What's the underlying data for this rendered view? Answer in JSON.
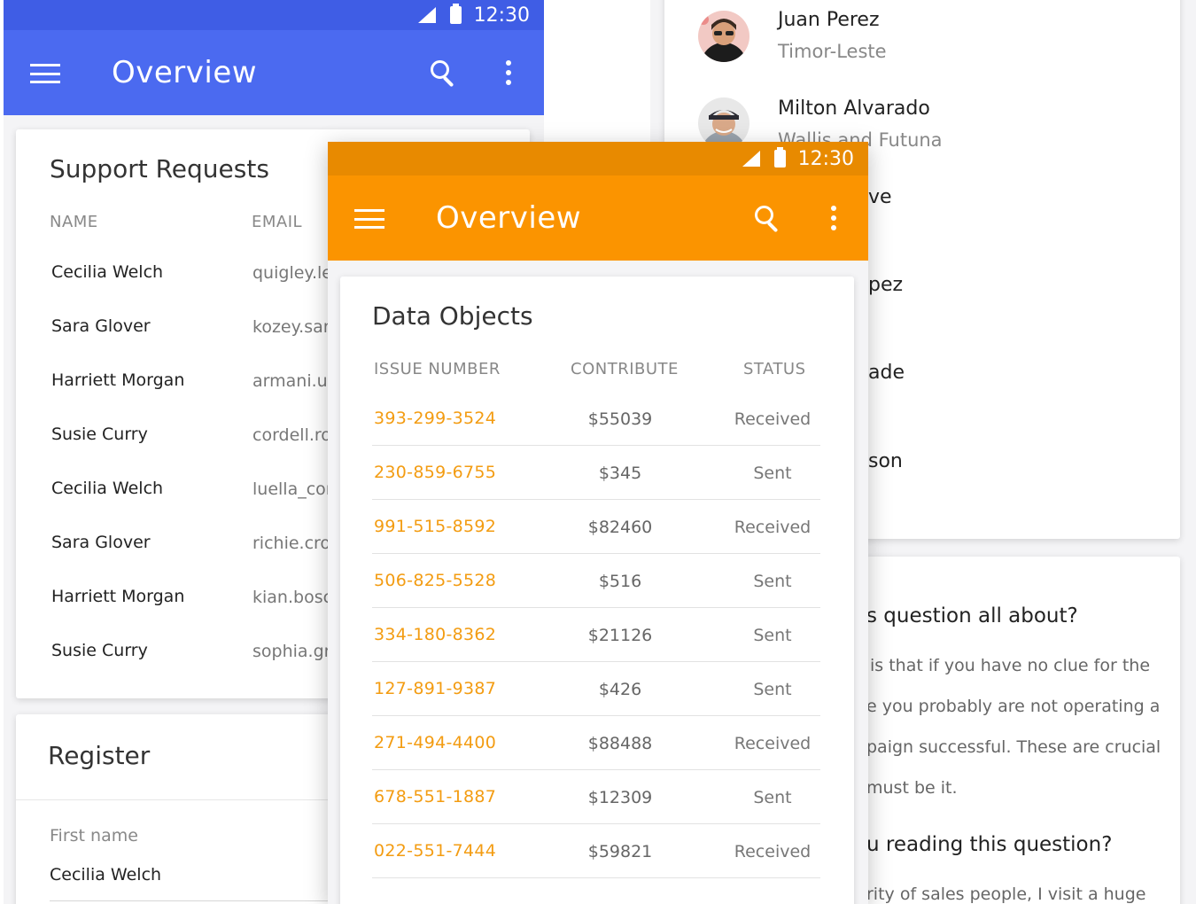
{
  "blue_phone": {
    "status_time": "12:30",
    "title": "Overview",
    "accent": "#4b6af0",
    "support": {
      "title": "Support Requests",
      "columns": [
        "NAME",
        "EMAIL"
      ],
      "rows": [
        {
          "name": "Cecilia Welch",
          "email": "quigley.le"
        },
        {
          "name": "Sara Glover",
          "email": "kozey.san"
        },
        {
          "name": "Harriett Morgan",
          "email": "armani.up"
        },
        {
          "name": "Susie Curry",
          "email": "cordell.ro"
        },
        {
          "name": "Cecilia Welch",
          "email": "luella_cor"
        },
        {
          "name": "Sara Glover",
          "email": "richie.cro"
        },
        {
          "name": "Harriett Morgan",
          "email": "kian.bosc"
        },
        {
          "name": "Susie Curry",
          "email": "sophia.gr"
        }
      ]
    },
    "register": {
      "title": "Register",
      "field_label": "First name",
      "field_value": "Cecilia Welch"
    }
  },
  "orange_phone": {
    "status_time": "12:30",
    "title": "Overview",
    "accent": "#fb9400",
    "data_objects": {
      "title": "Data Objects",
      "columns": [
        "ISSUE NUMBER",
        "CONTRIBUTE",
        "STATUS"
      ],
      "rows": [
        {
          "issue": "393-299-3524",
          "amount": "$55039",
          "status": "Received"
        },
        {
          "issue": "230-859-6755",
          "amount": "$345",
          "status": "Sent"
        },
        {
          "issue": "991-515-8592",
          "amount": "$82460",
          "status": "Received"
        },
        {
          "issue": "506-825-5528",
          "amount": "$516",
          "status": "Sent"
        },
        {
          "issue": "334-180-8362",
          "amount": "$21126",
          "status": "Sent"
        },
        {
          "issue": "127-891-9387",
          "amount": "$426",
          "status": "Sent"
        },
        {
          "issue": "271-494-4400",
          "amount": "$88488",
          "status": "Received"
        },
        {
          "issue": "678-551-1887",
          "amount": "$12309",
          "status": "Sent"
        },
        {
          "issue": "022-551-7444",
          "amount": "$59821",
          "status": "Received"
        }
      ]
    }
  },
  "white_phone": {
    "contacts": [
      {
        "name": "Juan Perez",
        "sub": "Timor-Leste"
      },
      {
        "name": "Milton Alvarado",
        "sub": "Wallis and Futuna"
      }
    ],
    "partial_names": [
      "ve",
      "pez",
      "ade",
      "son"
    ],
    "faq": {
      "heading_1": "s question all about?",
      "lines_1": [
        "is that if you have no clue for the",
        "e you probably are not operating a",
        "paign successful. These are crucial",
        "must be it."
      ],
      "heading_2": "u reading this question?",
      "lines_2": [
        "rity of sales people, I visit a huge"
      ]
    }
  }
}
